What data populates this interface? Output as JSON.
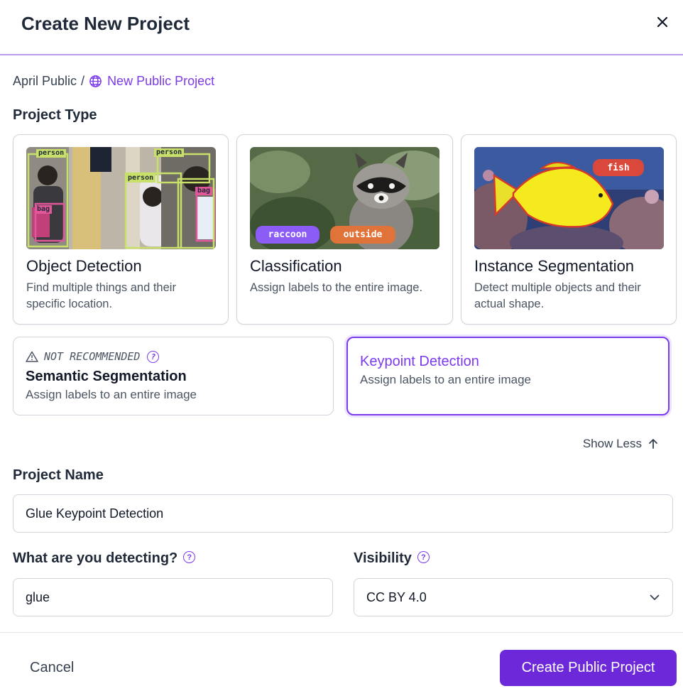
{
  "dialog": {
    "title": "Create New Project"
  },
  "breadcrumb": {
    "workspace": "April Public",
    "separator": "/",
    "project": "New Public Project"
  },
  "project_type": {
    "label": "Project Type",
    "cards": [
      {
        "title": "Object Detection",
        "description": "Find multiple things and their specific location.",
        "tags": [
          "person",
          "person",
          "person",
          "bag",
          "bag"
        ]
      },
      {
        "title": "Classification",
        "description": "Assign labels to the entire image.",
        "tags": [
          "raccoon",
          "outside"
        ]
      },
      {
        "title": "Instance Segmentation",
        "description": "Detect multiple objects and their actual shape.",
        "tags": [
          "fish"
        ]
      }
    ],
    "more": [
      {
        "badge": "NOT RECOMMENDED",
        "title": "Semantic Segmentation",
        "description": "Assign labels to an entire image",
        "selected": false
      },
      {
        "title": "Keypoint Detection",
        "description": "Assign labels to an entire image",
        "selected": true
      }
    ],
    "toggle_label": "Show Less"
  },
  "form": {
    "project_name": {
      "label": "Project Name",
      "value": "Glue Keypoint Detection"
    },
    "detecting": {
      "label": "What are you detecting?",
      "value": "glue"
    },
    "visibility": {
      "label": "Visibility",
      "value": "CC BY 4.0"
    }
  },
  "footer": {
    "cancel_label": "Cancel",
    "submit_label": "Create Public Project"
  },
  "colors": {
    "accent": "#7c3aed",
    "primary_button": "#6d28d9",
    "tag_purple": "#8b5cf6",
    "tag_orange": "#e0733a",
    "tag_red": "#d9483b"
  }
}
